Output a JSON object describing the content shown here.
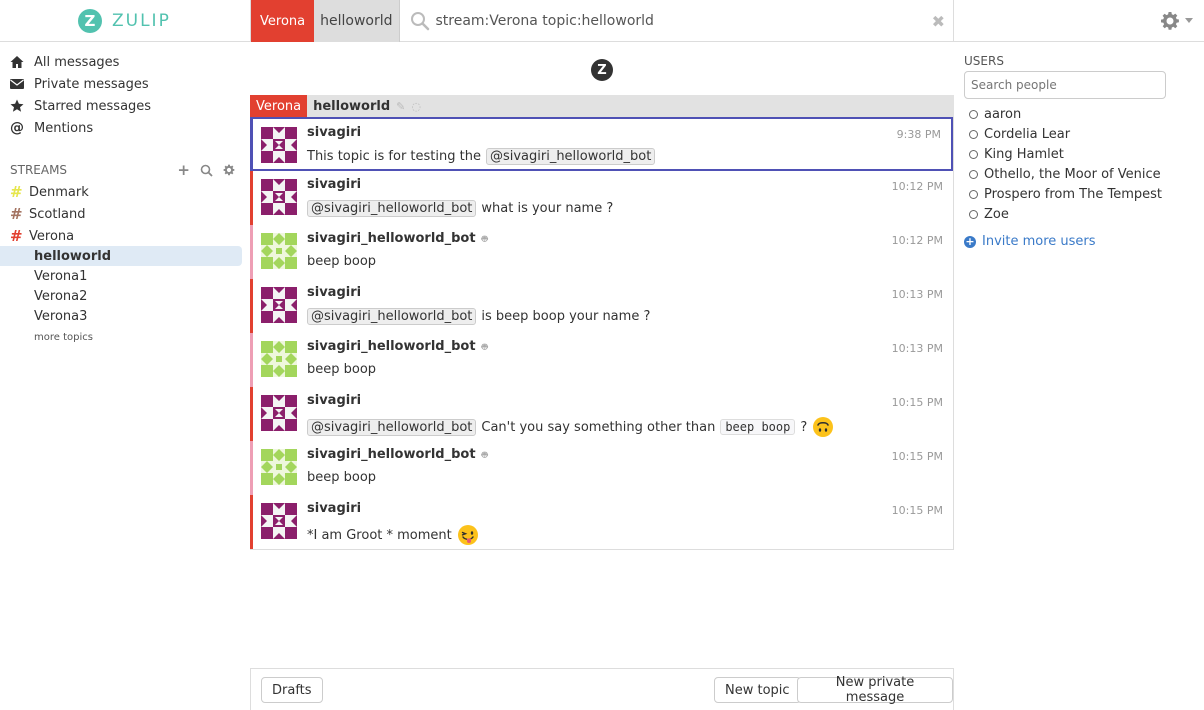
{
  "brand": {
    "logo_letter": "Z",
    "name": "ZULIP"
  },
  "header": {
    "stream": "Verona",
    "topic": "helloworld",
    "search_query": "stream:Verona topic:helloworld",
    "clear_glyph": "✖",
    "search_icon": "search-icon",
    "settings_icon": "gear-icon"
  },
  "nav": {
    "items": [
      {
        "label": "All messages",
        "icon": "home-icon"
      },
      {
        "label": "Private messages",
        "icon": "envelope-icon"
      },
      {
        "label": "Starred messages",
        "icon": "star-icon"
      },
      {
        "label": "Mentions",
        "icon": "at-icon"
      }
    ]
  },
  "streams": {
    "header": "STREAMS",
    "items": [
      {
        "name": "Denmark",
        "color": "#e6e64d"
      },
      {
        "name": "Scotland",
        "color": "#a47462"
      },
      {
        "name": "Verona",
        "color": "#e24030"
      }
    ],
    "topics": [
      "helloworld",
      "Verona1",
      "Verona2",
      "Verona3"
    ],
    "more_topics": "more topics"
  },
  "center": {
    "logo_letter": "Z",
    "recipient": {
      "stream": "Verona",
      "topic": "helloworld"
    }
  },
  "messages": [
    {
      "sender": "sivagiri",
      "time": "9:38 PM",
      "text_before": "This topic is for testing the",
      "mention": "@sivagiri_helloworld_bot",
      "bot": false
    },
    {
      "sender": "sivagiri",
      "time": "10:12 PM",
      "mention": "@sivagiri_helloworld_bot",
      "text_after": "what is your name ?",
      "bot": false
    },
    {
      "sender": "sivagiri_helloworld_bot",
      "time": "10:12 PM",
      "text": "beep boop",
      "bot": true
    },
    {
      "sender": "sivagiri",
      "time": "10:13 PM",
      "mention": "@sivagiri_helloworld_bot",
      "text_after": "is beep boop your name ?",
      "bot": false
    },
    {
      "sender": "sivagiri_helloworld_bot",
      "time": "10:13 PM",
      "text": "beep boop",
      "bot": true
    },
    {
      "sender": "sivagiri",
      "time": "10:15 PM",
      "mention": "@sivagiri_helloworld_bot",
      "text_after": "Can't you say something other than",
      "code": "beep boop",
      "text_end": "?",
      "bot": false
    },
    {
      "sender": "sivagiri_helloworld_bot",
      "time": "10:15 PM",
      "text": "beep boop",
      "bot": true
    },
    {
      "sender": "sivagiri",
      "time": "10:15 PM",
      "text": "*I am Groot * moment",
      "bot": false
    }
  ],
  "bottom": {
    "drafts": "Drafts",
    "new_topic": "New topic",
    "new_private": "New private message"
  },
  "users": {
    "title": "USERS",
    "search_placeholder": "Search people",
    "list": [
      "aaron",
      "Cordelia Lear",
      "King Hamlet",
      "Othello, the Moor of Venice",
      "Prospero from The Tempest",
      "Zoe"
    ],
    "invite": "Invite more users"
  },
  "colors": {
    "accent": "#52c2af",
    "stream_verona": "#e24030",
    "selected_border": "#4f51b5",
    "link": "#3a7ac8"
  }
}
